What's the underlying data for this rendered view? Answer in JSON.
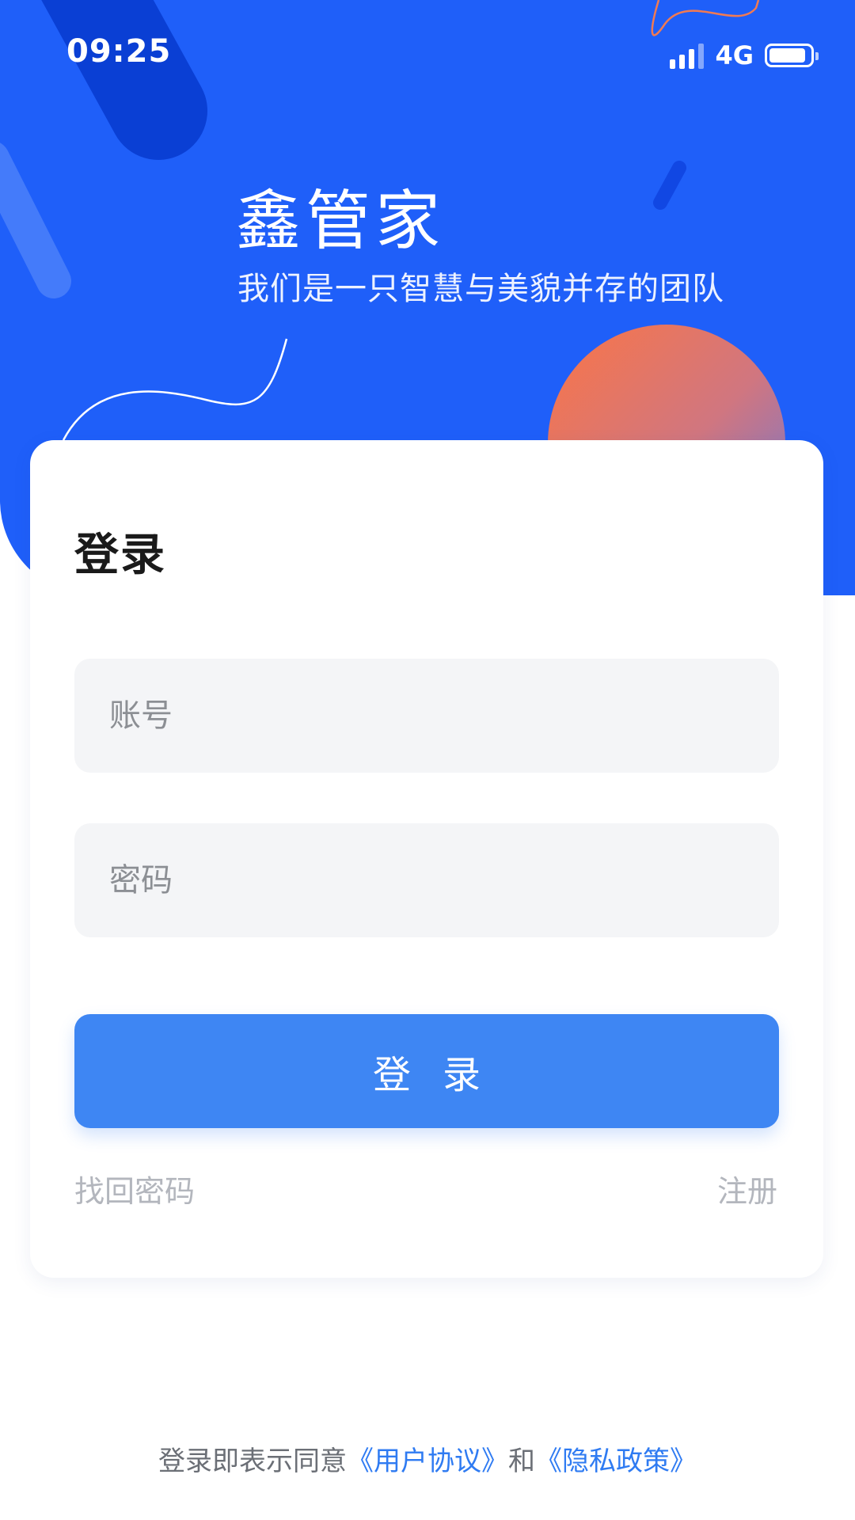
{
  "status_bar": {
    "time": "09:25",
    "network": "4G",
    "signal_bars_active": 3,
    "battery_level": 0.85
  },
  "hero": {
    "app_name": "鑫管家",
    "slogan": "我们是一只智慧与美貌并存的团队",
    "background_color": "#1f5ff9"
  },
  "login": {
    "title": "登录",
    "account_placeholder": "账号",
    "password_placeholder": "密码",
    "submit_label": "登录",
    "forgot_password": "找回密码",
    "register": "注册"
  },
  "agreement": {
    "prefix": "登录即表示同意",
    "user_agreement": "《用户协议》",
    "conjunction": "和",
    "privacy_policy": "《隐私政策》"
  },
  "colors": {
    "primary": "#1f5ff9",
    "button": "#3e86f3",
    "link": "#2f7bf2",
    "accent_orange": "#fb7546"
  },
  "icons": {
    "signal": "signal-icon",
    "battery": "battery-icon"
  }
}
